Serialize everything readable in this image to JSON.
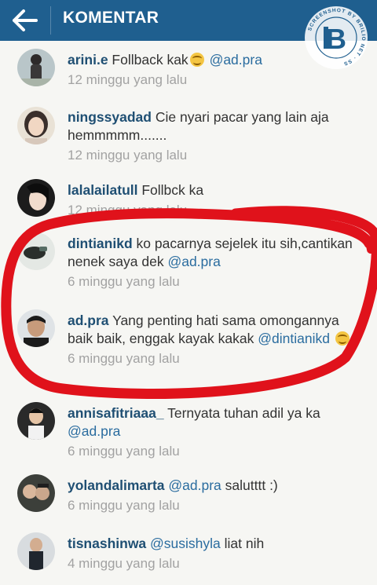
{
  "header": {
    "title": "KOMENTAR",
    "background_color": "#1f5f8f",
    "back_icon": "arrow-left-icon"
  },
  "watermark": {
    "ring_text": "SCREENSHOT BY BRILIO NET",
    "logo_letter": "B"
  },
  "comments": [
    {
      "username": "arini.e",
      "text": " Follback kak",
      "emoji": "smile-emoji",
      "mention": "@ad.pra",
      "time": "12 minggu yang lalu"
    },
    {
      "username": "ningssyadad",
      "text": " Cie nyari pacar yang lain aja hemmmmm.......",
      "time": "12 minggu yang lalu"
    },
    {
      "username": "lalalailatull",
      "text": " Follbck ka",
      "time": "12 minggu yang lalu"
    },
    {
      "username": "dintianikd",
      "text": " ko pacarnya sejelek itu sih,cantikan nenek saya dek ",
      "mention": "@ad.pra",
      "time": "6 minggu yang lalu"
    },
    {
      "username": "ad.pra",
      "text": " Yang penting hati sama omongannya baik baik, enggak kayak kakak ",
      "mention": "@dintianikd",
      "emoji": "smile-emoji",
      "time": "6 minggu yang lalu"
    },
    {
      "username": "annisafitriaaa_",
      "text": " Ternyata tuhan adil ya ka ",
      "mention": "@ad.pra",
      "time": "6 minggu yang lalu"
    },
    {
      "username": "yolandalimarta",
      "mention": "@ad.pra",
      "text_after": " salutttt :)",
      "time": "6 minggu yang lalu"
    },
    {
      "username": "tisnashinwa",
      "mention": "@susishyla",
      "text_after": " liat nih",
      "time": "4 minggu yang lalu"
    }
  ],
  "annotation": {
    "color": "#e0121b"
  }
}
